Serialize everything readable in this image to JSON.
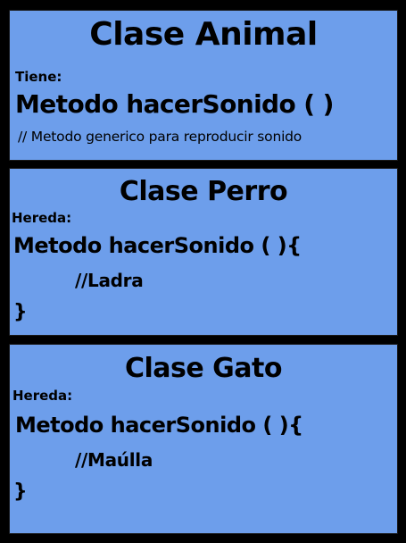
{
  "panels": [
    {
      "title": "Clase Animal",
      "label": "Tiene:",
      "method": "Metodo hacerSonido ( )",
      "comment": "// Metodo generico para reproducir sonido"
    },
    {
      "title": "Clase Perro",
      "label": "Hereda:",
      "method": "Metodo hacerSonido ( ){",
      "comment": "//Ladra",
      "closing": "}"
    },
    {
      "title": "Clase Gato",
      "label": "Hereda:",
      "method": "Metodo hacerSonido ( ){",
      "comment": "//Maúlla",
      "closing": "}"
    }
  ],
  "colors": {
    "background": "#000000",
    "panel": "#6d9eeb",
    "text": "#000000"
  }
}
